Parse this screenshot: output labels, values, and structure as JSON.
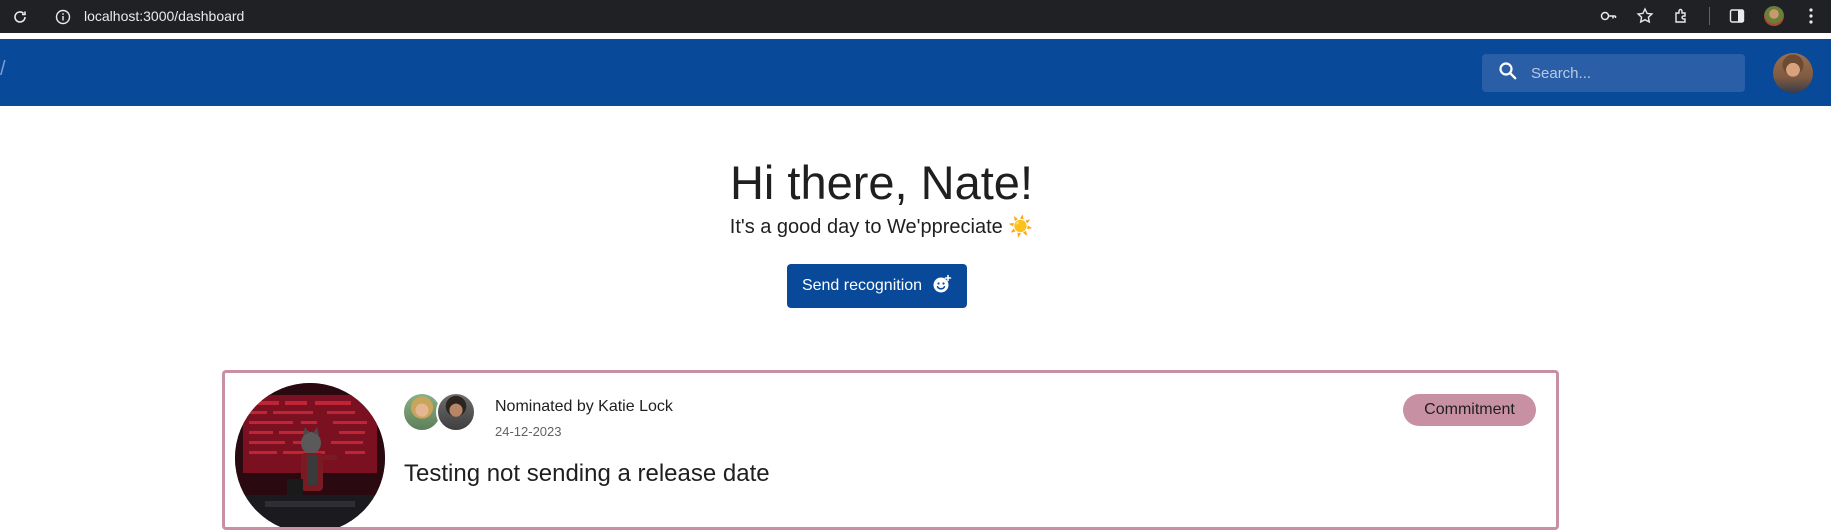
{
  "browser": {
    "url": "localhost:3000/dashboard"
  },
  "header": {
    "search_placeholder": "Search..."
  },
  "greeting": {
    "title": "Hi there, Nate!",
    "subtitle": "It's a good day to We'ppreciate ☀️"
  },
  "actions": {
    "send_label": "Send recognition"
  },
  "card": {
    "nominated_by": "Nominated by Katie Lock",
    "date": "24-12-2023",
    "badge": "Commitment",
    "title": "Testing not sending a release date"
  },
  "colors": {
    "primary": "#084999",
    "accent": "#c890a3",
    "chrome": "#202124"
  }
}
